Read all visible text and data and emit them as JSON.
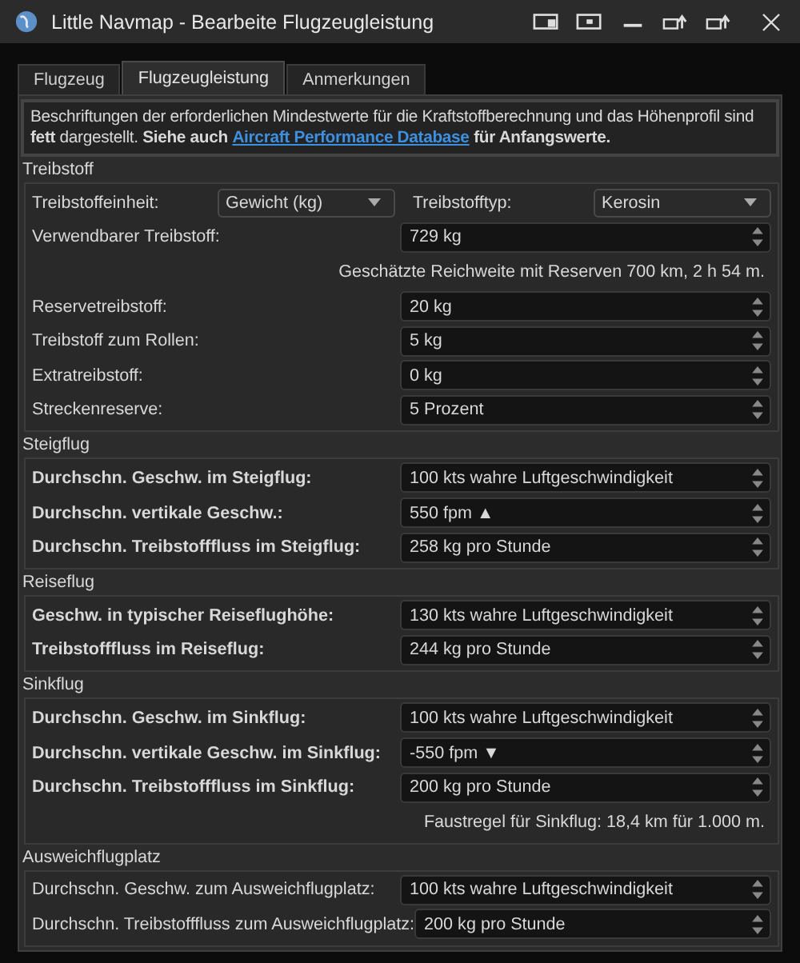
{
  "window": {
    "title": "Little Navmap - Bearbeite Flugzeugleistung"
  },
  "tabs": [
    {
      "label": "Flugzeug",
      "selected": false
    },
    {
      "label": "Flugzeugleistung",
      "selected": true
    },
    {
      "label": "Anmerkungen",
      "selected": false
    }
  ],
  "info": {
    "text": "Beschriftungen der erforderlichen Mindestwerte für die Kraftstoffberechnung und das Höhenprofil sind **fett** dargestellt. **Siehe auch**",
    "link": "Aircraft Performance Database",
    "text_after": "**für Anfangswerte.**"
  },
  "sections": [
    {
      "title": "Treibstoff",
      "rows": [
        {
          "kind": "combo-pair",
          "label": "Treibstoffeinheit:",
          "value": "Gewicht (kg)",
          "label_2": "Treibstofftyp:",
          "value_2": "Kerosin"
        },
        {
          "kind": "spin",
          "label": "Verwendbarer Treibstoff:",
          "value": "729 kg",
          "bold": false
        },
        {
          "kind": "note",
          "text": "Geschätzte Reichweite mit Reserven 700 km, 2 h 54 m."
        },
        {
          "kind": "spin",
          "label": "Reservetreibstoff:",
          "value": "20 kg",
          "bold": false
        },
        {
          "kind": "spin",
          "label": "Treibstoff zum Rollen:",
          "value": "5 kg",
          "bold": false
        },
        {
          "kind": "spin",
          "label": "Extratreibstoff:",
          "value": "0 kg",
          "bold": false
        },
        {
          "kind": "spin",
          "label": "Streckenreserve:",
          "value": "5 Prozent",
          "bold": false
        }
      ]
    },
    {
      "title": "Steigflug",
      "rows": [
        {
          "kind": "spin",
          "label": "Durchschn. Geschw. im Steigflug:",
          "value": "100 kts wahre Luftgeschwindigkeit",
          "bold": true
        },
        {
          "kind": "spin",
          "label": "Durchschn. vertikale Geschw.:",
          "value": "550 fpm ▲",
          "bold": true
        },
        {
          "kind": "spin",
          "label": "Durchschn. Treibstofffluss im Steigflug:",
          "value": "258 kg pro Stunde",
          "bold": true
        }
      ]
    },
    {
      "title": "Reiseflug",
      "rows": [
        {
          "kind": "spin",
          "label": "Geschw. in typischer Reiseflughöhe:",
          "value": "130 kts wahre Luftgeschwindigkeit",
          "bold": true
        },
        {
          "kind": "spin",
          "label": "Treibstofffluss im Reiseflug:",
          "value": "244 kg pro Stunde",
          "bold": true
        }
      ]
    },
    {
      "title": "Sinkflug",
      "rows": [
        {
          "kind": "spin",
          "label": "Durchschn. Geschw. im Sinkflug:",
          "value": "100 kts wahre Luftgeschwindigkeit",
          "bold": true
        },
        {
          "kind": "spin",
          "label": "Durchschn. vertikale Geschw. im Sinkflug:",
          "value": "-550 fpm ▼",
          "bold": true
        },
        {
          "kind": "spin",
          "label": "Durchschn. Treibstofffluss im Sinkflug:",
          "value": "200 kg pro Stunde",
          "bold": true
        },
        {
          "kind": "note",
          "text": "Faustregel für Sinkflug: 18,4 km für 1.000 m."
        }
      ]
    },
    {
      "title": "Ausweichflugplatz",
      "rows": [
        {
          "kind": "spin",
          "label": "Durchschn. Geschw. zum Ausweichflugplatz:",
          "value": "100 kts wahre Luftgeschwindigkeit",
          "bold": false
        },
        {
          "kind": "spin",
          "label": "Durchschn. Treibstofffluss zum Ausweichflugplatz:",
          "value": "200 kg pro Stunde",
          "bold": false
        }
      ]
    }
  ]
}
